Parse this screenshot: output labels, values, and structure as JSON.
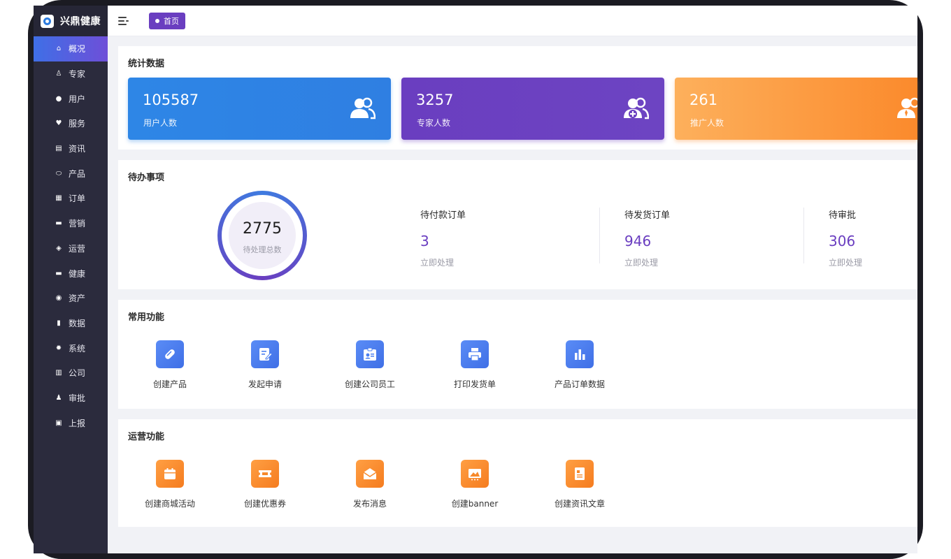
{
  "app": {
    "brand": "兴鼎健康"
  },
  "sidebar": {
    "items": [
      {
        "label": "概况",
        "icon": "home-icon",
        "glyph": "⌂",
        "active": true
      },
      {
        "label": "专家",
        "icon": "expert-icon",
        "glyph": "♙"
      },
      {
        "label": "用户",
        "icon": "user-icon",
        "glyph": "●"
      },
      {
        "label": "服务",
        "icon": "heart-plus-icon",
        "glyph": "♥"
      },
      {
        "label": "资讯",
        "icon": "news-icon",
        "glyph": "▤"
      },
      {
        "label": "产品",
        "icon": "pill-icon",
        "glyph": "⬭"
      },
      {
        "label": "订单",
        "icon": "order-icon",
        "glyph": "▦"
      },
      {
        "label": "营销",
        "icon": "marketing-icon",
        "glyph": "▬"
      },
      {
        "label": "运营",
        "icon": "shield-icon",
        "glyph": "◈"
      },
      {
        "label": "健康",
        "icon": "health-icon",
        "glyph": "▬"
      },
      {
        "label": "资产",
        "icon": "asset-icon",
        "glyph": "◉"
      },
      {
        "label": "数据",
        "icon": "chart-icon",
        "glyph": "▮"
      },
      {
        "label": "系统",
        "icon": "gear-icon",
        "glyph": "✹"
      },
      {
        "label": "公司",
        "icon": "building-icon",
        "glyph": "▥"
      },
      {
        "label": "审批",
        "icon": "stamp-icon",
        "glyph": "♟"
      },
      {
        "label": "上报",
        "icon": "report-icon",
        "glyph": "▣"
      }
    ]
  },
  "topbar": {
    "tag": "首页"
  },
  "stats": {
    "title": "统计数据",
    "cards": [
      {
        "value": "105587",
        "label": "用户人数",
        "icon": "users-icon",
        "color": "#2e86e6"
      },
      {
        "value": "3257",
        "label": "专家人数",
        "icon": "add-users-icon",
        "color": "#6a3ec0"
      },
      {
        "value": "261",
        "label": "推广人数",
        "icon": "promoter-icon",
        "color": "#fb8c2e"
      }
    ]
  },
  "todo": {
    "title": "待办事项",
    "total_value": "2775",
    "total_label": "待处理总数",
    "items": [
      {
        "title": "待付款订单",
        "value": "3",
        "link": "立即处理"
      },
      {
        "title": "待发货订单",
        "value": "946",
        "link": "立即处理"
      },
      {
        "title": "待审批",
        "value": "306",
        "link": "立即处理"
      }
    ]
  },
  "common": {
    "title": "常用功能",
    "items": [
      {
        "label": "创建产品",
        "icon": "pill-icon"
      },
      {
        "label": "发起申请",
        "icon": "edit-form-icon"
      },
      {
        "label": "创建公司员工",
        "icon": "id-badge-icon"
      },
      {
        "label": "打印发货单",
        "icon": "printer-icon"
      },
      {
        "label": "产品订单数据",
        "icon": "bar-chart-icon"
      }
    ]
  },
  "operations": {
    "title": "运营功能",
    "items": [
      {
        "label": "创建商城活动",
        "icon": "calendar-icon"
      },
      {
        "label": "创建优惠券",
        "icon": "ticket-icon"
      },
      {
        "label": "发布消息",
        "icon": "envelope-icon"
      },
      {
        "label": "创建banner",
        "icon": "image-icon"
      },
      {
        "label": "创建资讯文章",
        "icon": "article-icon"
      }
    ]
  }
}
